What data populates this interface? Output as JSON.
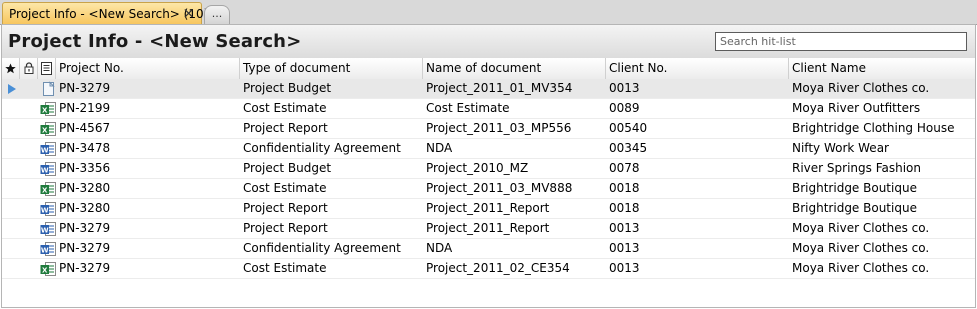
{
  "tabs": {
    "active_label": "Project Info - <New Search> (10)",
    "close_glyph": "×",
    "more_glyph": "..."
  },
  "header": {
    "title": "Project Info - <New Search>",
    "search_placeholder": "Search hit-list"
  },
  "columns": {
    "favorite_icon": "star-icon",
    "lock_icon": "lock-icon",
    "doc_icon": "document-icon",
    "project_no": "Project No.",
    "type": "Type of document",
    "name": "Name of document",
    "client_no": "Client No.",
    "client_name": "Client Name"
  },
  "colors": {
    "excel": "#1f7a3c",
    "word": "#2b5fae",
    "selection": "#e8e8e8",
    "tab_active": "#f7c65e"
  },
  "rows": [
    {
      "doc": "generic",
      "project_no": "PN-3279",
      "type": "Project Budget",
      "name": "Project_2011_01_MV354",
      "client_no": "0013",
      "client_name": "Moya River Clothes co.",
      "selected": true
    },
    {
      "doc": "excel",
      "project_no": "PN-2199",
      "type": "Cost Estimate",
      "name": "Cost Estimate",
      "client_no": "0089",
      "client_name": "Moya River Outfitters",
      "selected": false
    },
    {
      "doc": "excel",
      "project_no": "PN-4567",
      "type": "Project Report",
      "name": "Project_2011_03_MP556",
      "client_no": "00540",
      "client_name": "Brightridge Clothing House",
      "selected": false
    },
    {
      "doc": "word",
      "project_no": "PN-3478",
      "type": "Confidentiality Agreement",
      "name": "NDA",
      "client_no": "00345",
      "client_name": "Nifty Work Wear",
      "selected": false
    },
    {
      "doc": "word",
      "project_no": "PN-3356",
      "type": "Project Budget",
      "name": "Project_2010_MZ",
      "client_no": "0078",
      "client_name": "River Springs Fashion",
      "selected": false
    },
    {
      "doc": "excel",
      "project_no": "PN-3280",
      "type": "Cost Estimate",
      "name": "Project_2011_03_MV888",
      "client_no": "0018",
      "client_name": "Brightridge Boutique",
      "selected": false
    },
    {
      "doc": "word",
      "project_no": "PN-3280",
      "type": "Project Report",
      "name": "Project_2011_Report",
      "client_no": "0018",
      "client_name": "Brightridge Boutique",
      "selected": false
    },
    {
      "doc": "word",
      "project_no": "PN-3279",
      "type": "Project Report",
      "name": "Project_2011_Report",
      "client_no": "0013",
      "client_name": "Moya River Clothes co.",
      "selected": false
    },
    {
      "doc": "word",
      "project_no": "PN-3279",
      "type": "Confidentiality Agreement",
      "name": "NDA",
      "client_no": "0013",
      "client_name": "Moya River Clothes co.",
      "selected": false
    },
    {
      "doc": "excel",
      "project_no": "PN-3279",
      "type": "Cost Estimate",
      "name": "Project_2011_02_CE354",
      "client_no": "0013",
      "client_name": "Moya River Clothes co.",
      "selected": false
    }
  ]
}
